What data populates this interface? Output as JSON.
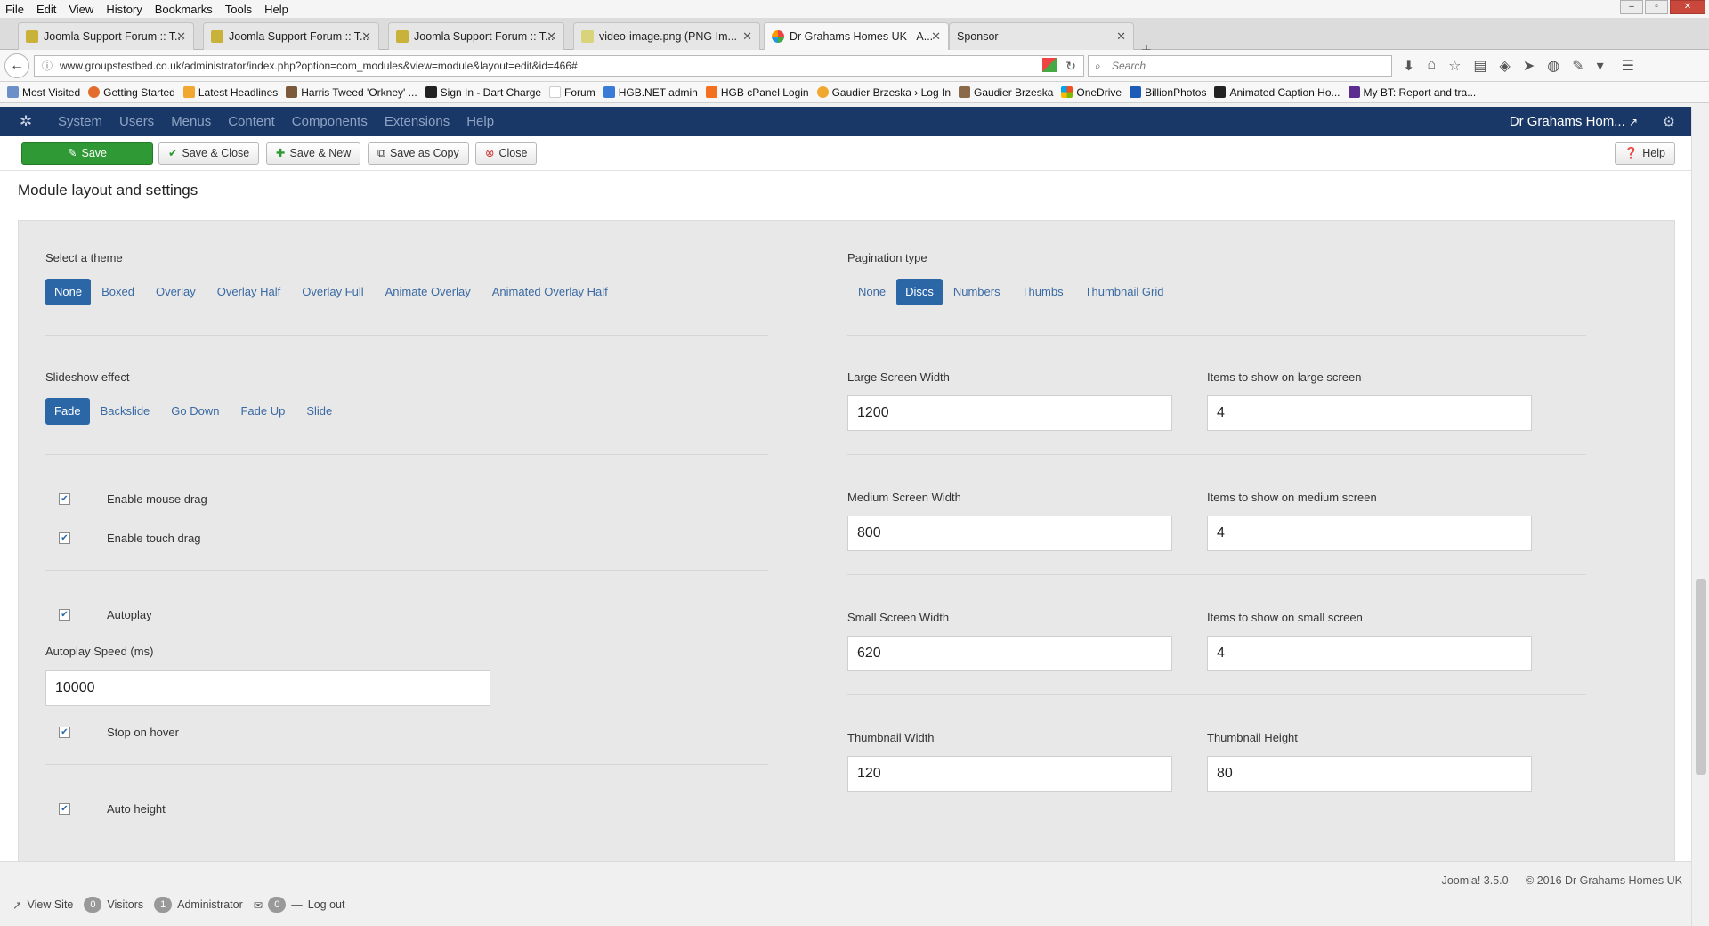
{
  "menubar": {
    "items": [
      "File",
      "Edit",
      "View",
      "History",
      "Bookmarks",
      "Tools",
      "Help"
    ]
  },
  "tabs": [
    {
      "label": "Joomla Support Forum :: T..."
    },
    {
      "label": "Joomla Support Forum :: T..."
    },
    {
      "label": "Joomla Support Forum :: T..."
    },
    {
      "label": "video-image.png (PNG Im..."
    },
    {
      "label": "Dr Grahams Homes UK - A..."
    },
    {
      "label": "Sponsor"
    }
  ],
  "url": "www.groupstestbed.co.uk/administrator/index.php?option=com_modules&view=module&layout=edit&id=466#",
  "search_placeholder": "Search",
  "bookmarks": [
    "Most Visited",
    "Getting Started",
    "Latest Headlines",
    "Harris Tweed 'Orkney' ...",
    "Sign In - Dart Charge",
    "Forum",
    "HGB.NET admin",
    "HGB cPanel Login",
    "Gaudier Brzeska › Log In",
    "Gaudier Brzeska",
    "OneDrive",
    "BillionPhotos",
    "Animated Caption Ho...",
    "My BT: Report and tra..."
  ],
  "joomla_nav": {
    "menu": [
      "System",
      "Users",
      "Menus",
      "Content",
      "Components",
      "Extensions",
      "Help"
    ],
    "site_name": "Dr Grahams Hom..."
  },
  "toolbar": {
    "save": "Save",
    "save_close": "Save & Close",
    "save_new": "Save & New",
    "save_copy": "Save as Copy",
    "close": "Close",
    "help": "Help"
  },
  "section_title": "Module layout and settings",
  "theme": {
    "label": "Select a theme",
    "options": [
      "None",
      "Boxed",
      "Overlay",
      "Overlay Half",
      "Overlay Full",
      "Animate Overlay",
      "Animated Overlay Half"
    ],
    "selected": "None"
  },
  "effect": {
    "label": "Slideshow effect",
    "options": [
      "Fade",
      "Backslide",
      "Go Down",
      "Fade Up",
      "Slide"
    ],
    "selected": "Fade"
  },
  "checks": {
    "mouse_drag": "Enable mouse drag",
    "touch_drag": "Enable touch drag",
    "autoplay": "Autoplay",
    "stop_hover": "Stop on hover",
    "auto_height": "Auto height"
  },
  "autoplay_speed": {
    "label": "Autoplay Speed (ms)",
    "value": "10000"
  },
  "pagination": {
    "label": "Pagination type",
    "options": [
      "None",
      "Discs",
      "Numbers",
      "Thumbs",
      "Thumbnail Grid"
    ],
    "selected": "Discs"
  },
  "fields": {
    "large_width": {
      "label": "Large Screen Width",
      "value": "1200"
    },
    "large_items": {
      "label": "Items to show on large screen",
      "value": "4"
    },
    "medium_width": {
      "label": "Medium Screen Width",
      "value": "800"
    },
    "medium_items": {
      "label": "Items to show on medium screen",
      "value": "4"
    },
    "small_width": {
      "label": "Small Screen Width",
      "value": "620"
    },
    "small_items": {
      "label": "Items to show on small screen",
      "value": "4"
    },
    "thumb_width": {
      "label": "Thumbnail Width",
      "value": "120"
    },
    "thumb_height": {
      "label": "Thumbnail Height",
      "value": "80"
    }
  },
  "footer": {
    "copyright": "Joomla! 3.5.0 — © 2016 Dr Grahams Homes UK",
    "view_site": "View Site",
    "visitors_count": "0",
    "visitors": "Visitors",
    "admin_count": "1",
    "admin": "Administrator",
    "messages_count": "0",
    "logout": "Log out"
  },
  "colors": {
    "joomla_nav": "#1a3867",
    "selected_option": "#2b67a7",
    "save_button": "#2f9a35"
  }
}
